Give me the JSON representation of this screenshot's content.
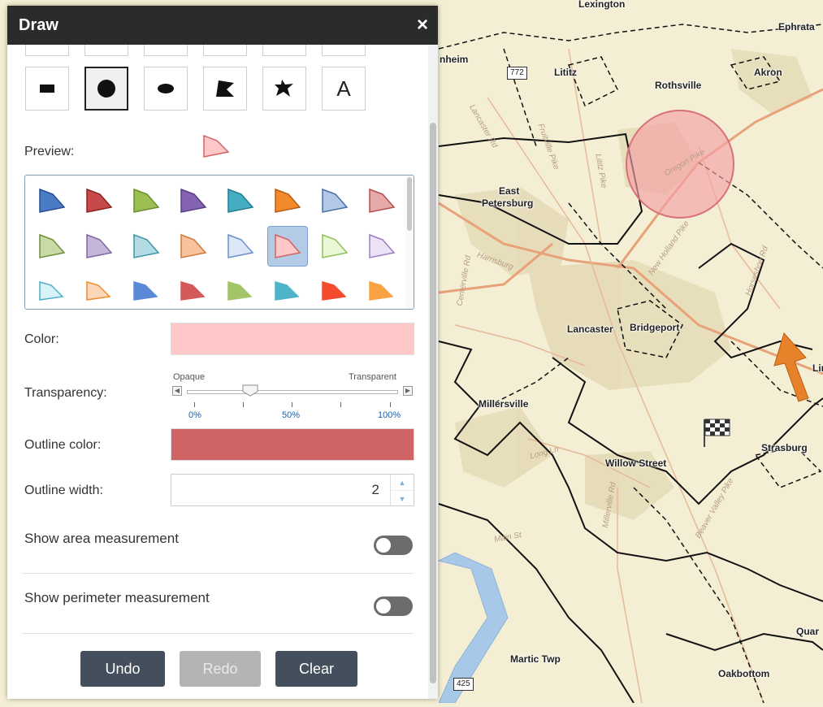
{
  "panel": {
    "title": "Draw",
    "close_symbol": "×"
  },
  "tools": [
    {
      "name": "rectangle-tool",
      "icon": "filled-rectangle-icon"
    },
    {
      "name": "circle-tool",
      "icon": "filled-circle-icon",
      "selected": true
    },
    {
      "name": "ellipse-tool",
      "icon": "filled-ellipse-icon"
    },
    {
      "name": "polygon-tool",
      "icon": "filled-polygon-icon"
    },
    {
      "name": "freehand-polygon-tool",
      "icon": "freehand-polygon-icon"
    },
    {
      "name": "text-tool",
      "icon": "text-a-icon",
      "letter": "A"
    }
  ],
  "preview": {
    "label": "Preview:",
    "fill": "#ffc8c8",
    "stroke": "#d06464"
  },
  "palette": {
    "swatches": [
      {
        "fill": "#4a7bc4",
        "stroke": "#234f8f"
      },
      {
        "fill": "#c64a4a",
        "stroke": "#8c2323"
      },
      {
        "fill": "#9bbf52",
        "stroke": "#6a8d2c"
      },
      {
        "fill": "#8463b1",
        "stroke": "#5a3e85"
      },
      {
        "fill": "#45adc2",
        "stroke": "#237b8f"
      },
      {
        "fill": "#f08a2c",
        "stroke": "#b85c12"
      },
      {
        "fill": "#b3c8e6",
        "stroke": "#4a6fa8"
      },
      {
        "fill": "#e6a9a9",
        "stroke": "#b24e4e"
      },
      {
        "fill": "#c8dba7",
        "stroke": "#6f8d3a"
      },
      {
        "fill": "#c5b6d9",
        "stroke": "#7d69a1"
      },
      {
        "fill": "#b2dbe3",
        "stroke": "#3e96a8"
      },
      {
        "fill": "#f7c39e",
        "stroke": "#d07a3a"
      },
      {
        "fill": "#dbe6f7",
        "stroke": "#6a8fd0"
      },
      {
        "fill": "#ffc8c8",
        "stroke": "#d06464",
        "selected": true
      },
      {
        "fill": "#eaf7d6",
        "stroke": "#8fbf5a"
      },
      {
        "fill": "#ece2f5",
        "stroke": "#9a7dc3"
      },
      {
        "fill": "#d8f2f7",
        "stroke": "#4ab0c8"
      },
      {
        "fill": "#fcd6b8",
        "stroke": "#f08a2c"
      },
      {
        "fill": "#5a8ad6",
        "stroke": "#5a8ad6"
      },
      {
        "fill": "#d45a5a",
        "stroke": "#d45a5a"
      },
      {
        "fill": "#a3c468",
        "stroke": "#a3c468"
      },
      {
        "fill": "#4fb3c9",
        "stroke": "#4fb3c9"
      },
      {
        "fill": "#f24b2e",
        "stroke": "#f24b2e"
      },
      {
        "fill": "#f7a344",
        "stroke": "#f7a344"
      }
    ]
  },
  "color": {
    "label": "Color:",
    "value": "#ffc8c8"
  },
  "transparency": {
    "label": "Transparency:",
    "left_caption": "Opaque",
    "right_caption": "Transparent",
    "tick_labels": [
      "0%",
      "50%",
      "100%"
    ],
    "value_percent": 30
  },
  "outline_color": {
    "label": "Outline color:",
    "value": "#d06464"
  },
  "outline_width": {
    "label": "Outline width:",
    "value": "2"
  },
  "area_measure": {
    "label": "Show area measurement",
    "on": false
  },
  "perimeter_measure": {
    "label": "Show perimeter measurement",
    "on": false
  },
  "actions": {
    "undo": "Undo",
    "redo": "Redo",
    "clear": "Clear"
  },
  "map": {
    "places": [
      "Lexington",
      "Ephrata",
      "nheim",
      "Lititz",
      "Rothsville",
      "Akron",
      "East",
      "Petersburg",
      "Lancaster",
      "Bridgeport",
      "Millersville",
      "Strasburg",
      "Willow Street",
      "Martic Twp",
      "Oakbottom",
      "Quar"
    ],
    "roads": [
      "Lancaster Rd",
      "Fruitville Pike",
      "Lititz Pike",
      "New Holland Pike",
      "Horseshoe Rd",
      "Harrisburg",
      "Centerville Rd",
      "Long Ln",
      "Beaver Valley Pike",
      "Millerville Rd",
      "Main St",
      "Oregon Pike"
    ],
    "shields": [
      "772",
      "425"
    ],
    "highway_fragment": "Lin",
    "circle_fill": "#f5a0a8",
    "arrow_color": "#e8822a"
  }
}
